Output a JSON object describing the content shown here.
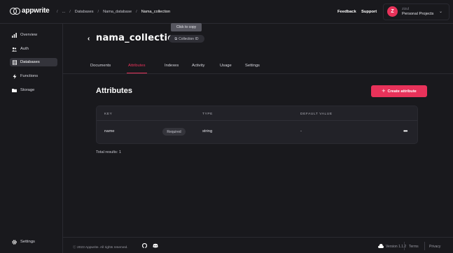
{
  "app": {
    "logo_text": "appwrite"
  },
  "breadcrumbs": [
    "/",
    "...",
    "/",
    "Databases",
    "/",
    "Nama_database",
    "/",
    "Nama_collection"
  ],
  "topbar": {
    "feedback": "Feedback",
    "support": "Support"
  },
  "user": {
    "initial": "Z",
    "name": "zizul",
    "project": "Personal Projects"
  },
  "sidebar": {
    "items": [
      {
        "label": "Overview",
        "icon": "chart-icon",
        "glyph": "▮"
      },
      {
        "label": "Auth",
        "icon": "users-icon",
        "glyph": "⚇"
      },
      {
        "label": "Databases",
        "icon": "database-icon",
        "glyph": "▤"
      },
      {
        "label": "Functions",
        "icon": "lightning-icon",
        "glyph": "ϟ"
      },
      {
        "label": "Storage",
        "icon": "folder-icon",
        "glyph": "▬"
      }
    ],
    "settings": {
      "label": "Settings",
      "icon": "gear-icon",
      "glyph": "⚙"
    }
  },
  "collection": {
    "title": "nama_collection",
    "tooltip": "Click to copy",
    "id_pill": "Collection ID"
  },
  "tabs": [
    "Documents",
    "Attributes",
    "Indexes",
    "Activity",
    "Usage",
    "Settings"
  ],
  "attributes": {
    "heading": "Attributes",
    "create_label": "Create attribute",
    "columns": [
      "KEY",
      "TYPE",
      "DEFAULT VALUE"
    ],
    "rows": [
      {
        "key": "name",
        "badge": "Required",
        "type": "string",
        "default": "-"
      }
    ],
    "total": "Total results: 1"
  },
  "footer": {
    "copyright": "ⓒ 2023 Appwrite. All rights reserved.",
    "version": "Version 1.1.2",
    "terms": "Terms",
    "privacy": "Privacy"
  },
  "colors": {
    "accent": "#e8325a",
    "background": "#19191d"
  }
}
